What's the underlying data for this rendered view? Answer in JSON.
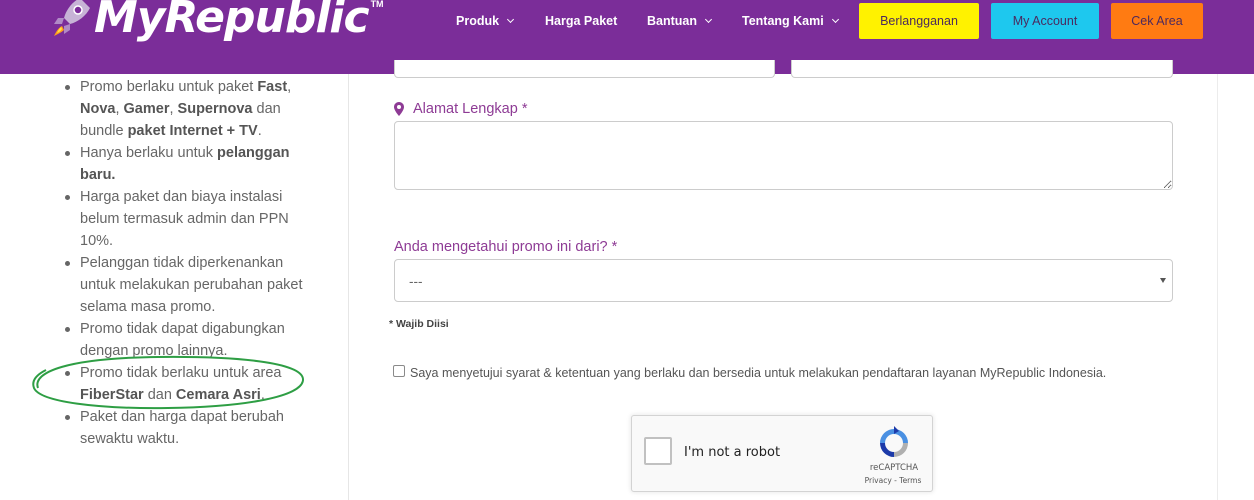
{
  "colors": {
    "header_bg": "#7b2d99",
    "label_purple": "#8e3b95",
    "subscribe_bg": "#fff200",
    "account_bg": "#1ec8ee",
    "area_bg": "#ff7b12",
    "annotation_circle": "#2e9e44"
  },
  "brand": {
    "name": "MyRepublic",
    "tm": "TM",
    "icon": "rocket-icon"
  },
  "nav": {
    "items": [
      {
        "label": "Produk",
        "dropdown": true
      },
      {
        "label": "Harga Paket",
        "dropdown": false
      },
      {
        "label": "Bantuan",
        "dropdown": true
      },
      {
        "label": "Tentang Kami",
        "dropdown": true
      }
    ],
    "buttons": {
      "subscribe": "Berlangganan",
      "account": "My Account",
      "area": "Cek Area"
    }
  },
  "terms": {
    "items": [
      {
        "parts": [
          {
            "t": "Promo berlaku untuk paket "
          },
          {
            "b": "Fast"
          },
          {
            "t": ", "
          },
          {
            "b": "Nova"
          },
          {
            "t": ", "
          },
          {
            "b": "Gamer"
          },
          {
            "t": ", "
          },
          {
            "b": "Supernova"
          },
          {
            "t": " dan bundle "
          },
          {
            "b": "paket Internet + TV"
          },
          {
            "t": "."
          }
        ]
      },
      {
        "parts": [
          {
            "t": "Hanya berlaku untuk "
          },
          {
            "b": "pelanggan baru."
          }
        ]
      },
      {
        "parts": [
          {
            "t": "Harga paket dan biaya instalasi belum termasuk admin dan PPN 10%."
          }
        ]
      },
      {
        "parts": [
          {
            "t": "Pelanggan tidak diperkenankan untuk melakukan perubahan paket selama masa promo."
          }
        ]
      },
      {
        "parts": [
          {
            "t": "Promo tidak dapat digabungkan dengan promo lainnya."
          }
        ]
      },
      {
        "parts": [
          {
            "t": "Promo tidak berlaku untuk area "
          },
          {
            "b": "FiberStar"
          },
          {
            "t": " dan "
          },
          {
            "b": "Cemara Asri"
          },
          {
            "t": "."
          }
        ]
      },
      {
        "parts": [
          {
            "t": "Paket dan harga dapat berubah sewaktu waktu."
          }
        ]
      }
    ]
  },
  "form": {
    "address": {
      "icon": "map-pin-icon",
      "label": "Alamat Lengkap *",
      "value": ""
    },
    "promo_source": {
      "label": "Anda mengetahui promo ini dari? *",
      "selected": "---"
    },
    "required_note": "* Wajib Diisi",
    "agreement": {
      "checked": false,
      "text": "Saya menyetujui syarat & ketentuan yang berlaku dan bersedia untuk melakukan pendaftaran layanan MyRepublic Indonesia."
    }
  },
  "captcha": {
    "label": "I'm not a robot",
    "brand": "reCAPTCHA",
    "privacy": "Privacy",
    "separator": " - ",
    "terms": "Terms"
  }
}
